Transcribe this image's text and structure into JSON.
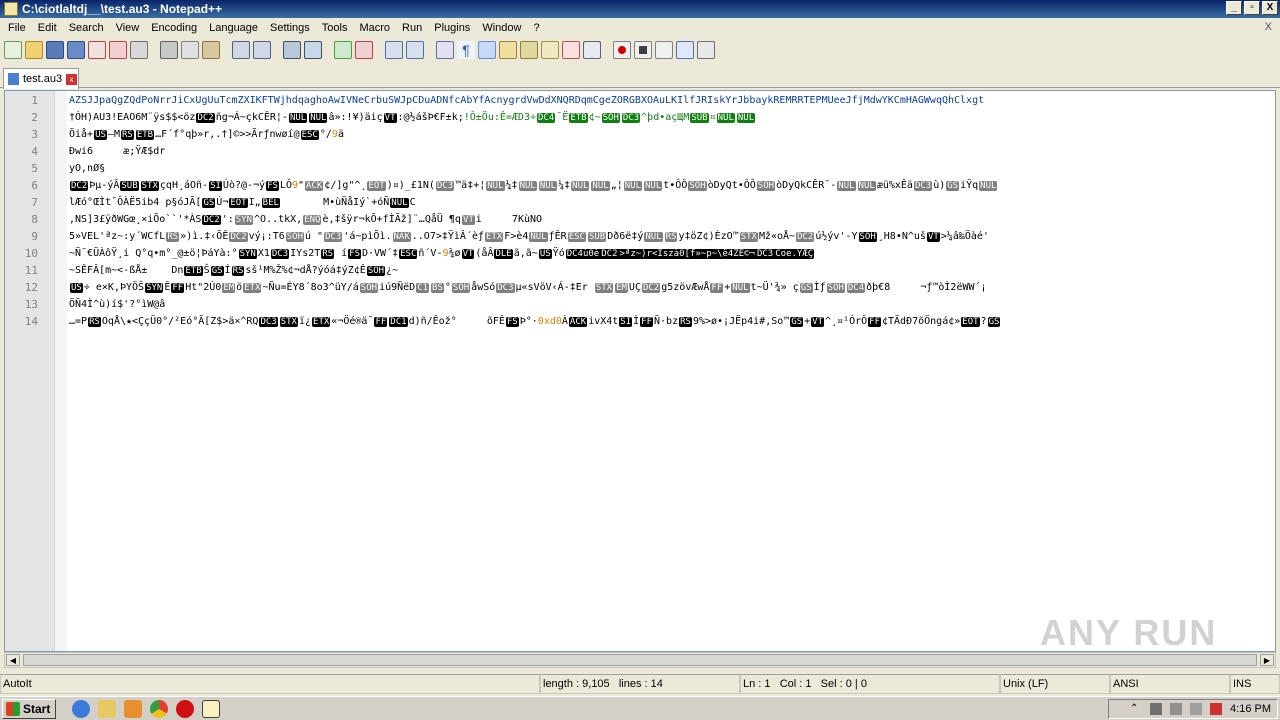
{
  "window": {
    "title": "C:\\ciotlaltdj__\\test.au3 - Notepad++",
    "controls": [
      "_",
      "▫",
      "X"
    ]
  },
  "menubar": [
    "File",
    "Edit",
    "Search",
    "View",
    "Encoding",
    "Language",
    "Settings",
    "Tools",
    "Macro",
    "Run",
    "Plugins",
    "Window",
    "?"
  ],
  "menubar_close": "X",
  "tabs": [
    {
      "label": "test.au3",
      "close": "x"
    }
  ],
  "editor": {
    "line_numbers": [
      "1",
      "2",
      "3",
      "4",
      "5",
      "6",
      "7",
      "8",
      "9",
      "10",
      "11",
      "12",
      "13",
      "14"
    ],
    "lines": [
      "AZSJJpaQgZQdPoNrrJiCxUgUuTcmZXIKFTWjhdqaghoAwIVNeCrbuSWJpCDuADNfcAbYfAcnygrdVwDdXNQRDqmCgeZORGBXOAuLKIlfJRIskYrJbbaykREMRRTEPMUeeJfjMdwYKCmHAGWwqQhClxgt",
      "†ÓH)AU3!EAO6M¨ÿs$$<öz",
      "Õiå+",
      "Ðwi6     æ;ŸÆ$dr",
      "yO,nØ§",
      "",
      "lÆó°ŒÌt¯ÔÀË5ib4 p§óJÃ[",
      ",NS]3£ÿðWGœ¸×iÕo``'",
      "5»VEL'ªz~:y´WCfL",
      "~Ñ¯€ÜÀôŸ¸i Q°q•m°_@±ö¦ÞáYà:°",
      "~SÊFÂ[m~<-ßÅ±    Dn",
      "",
      "ÖÑ4Ì^ù)í$'?°ìW@â",
      "…=P"
    ]
  },
  "watermark": "ANY RUN",
  "statusbar": {
    "lang": "AutoIt",
    "length": "length : 9,105",
    "lines": "lines : 14",
    "ln": "Ln : 1",
    "col": "Col : 1",
    "sel": "Sel : 0 | 0",
    "eol": "Unix (LF)",
    "encoding": "ANSI",
    "mode": "INS"
  },
  "taskbar": {
    "start_label": "Start",
    "clock": "4:16 PM"
  }
}
